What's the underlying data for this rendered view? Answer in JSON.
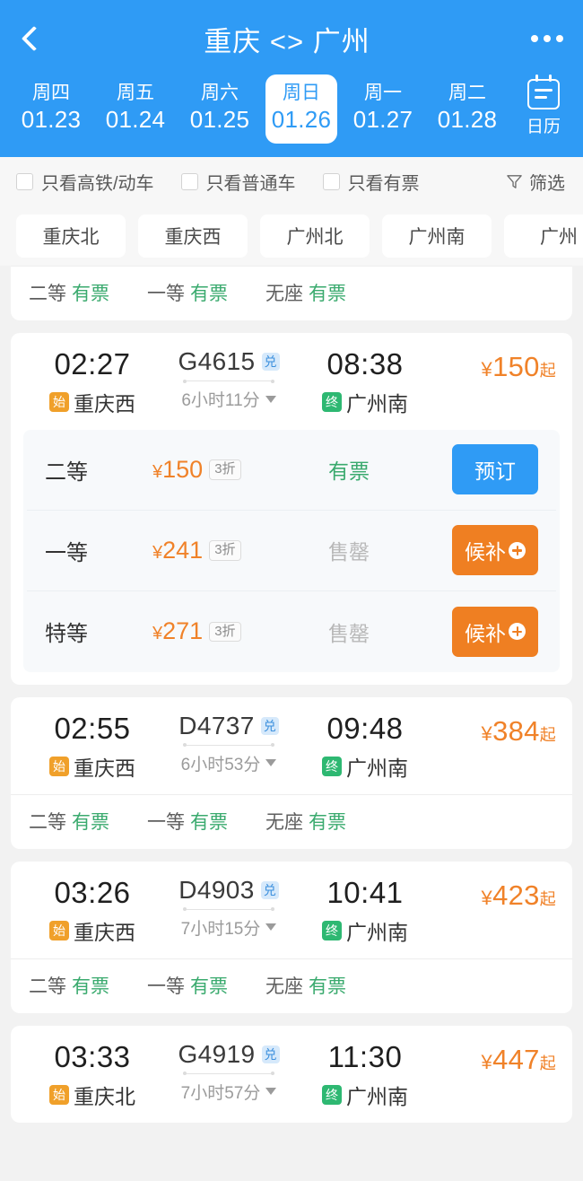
{
  "header": {
    "title": "重庆 <> 广州",
    "back_icon": "chevron-left-icon",
    "more_icon": "more-horizontal-icon",
    "calendar": {
      "icon": "calendar-icon",
      "label": "日历"
    },
    "dates": [
      {
        "dow": "周四",
        "date": "01.23",
        "active": false
      },
      {
        "dow": "周五",
        "date": "01.24",
        "active": false
      },
      {
        "dow": "周六",
        "date": "01.25",
        "active": false
      },
      {
        "dow": "周日",
        "date": "01.26",
        "active": true
      },
      {
        "dow": "周一",
        "date": "01.27",
        "active": false
      },
      {
        "dow": "周二",
        "date": "01.28",
        "active": false
      }
    ]
  },
  "filters": {
    "checkboxes": [
      {
        "label": "只看高铁/动车",
        "checked": false
      },
      {
        "label": "只看普通车",
        "checked": false
      },
      {
        "label": "只看有票",
        "checked": false
      }
    ],
    "filter_button": {
      "label": "筛选",
      "icon": "funnel-icon"
    }
  },
  "station_chips": [
    "重庆北",
    "重庆西",
    "广州北",
    "广州南",
    "广州"
  ],
  "partial_card": {
    "seats": [
      {
        "class": "二等",
        "status": "有票",
        "sold_out": false
      },
      {
        "class": "一等",
        "status": "有票",
        "sold_out": false
      },
      {
        "class": "无座",
        "status": "有票",
        "sold_out": false
      }
    ]
  },
  "colors": {
    "brand_blue": "#2f9bf5",
    "price_orange": "#f08229",
    "wait_orange": "#ef7f22",
    "avail_green": "#3aaa6e",
    "sold_gray": "#b8b8b8",
    "start_tag": "#f0a02a",
    "end_tag": "#2eb872"
  },
  "trains": [
    {
      "depart_time": "02:27",
      "depart_station": "重庆西",
      "depart_tag": "始",
      "code": "G4615",
      "code_badge": "兑",
      "duration": "6小时11分",
      "arrive_time": "08:38",
      "arrive_station": "广州南",
      "arrive_tag": "终",
      "price_prefix": "¥",
      "price": "150",
      "price_suffix": "起",
      "expanded": true,
      "seat_rows": [
        {
          "class": "二等",
          "price": "150",
          "discount": "3折",
          "status": "有票",
          "sold_out": false,
          "action": "预订",
          "action_type": "book"
        },
        {
          "class": "一等",
          "price": "241",
          "discount": "3折",
          "status": "售罄",
          "sold_out": true,
          "action": "候补",
          "action_type": "wait"
        },
        {
          "class": "特等",
          "price": "271",
          "discount": "3折",
          "status": "售罄",
          "sold_out": true,
          "action": "候补",
          "action_type": "wait"
        }
      ]
    },
    {
      "depart_time": "02:55",
      "depart_station": "重庆西",
      "depart_tag": "始",
      "code": "D4737",
      "code_badge": "兑",
      "duration": "6小时53分",
      "arrive_time": "09:48",
      "arrive_station": "广州南",
      "arrive_tag": "终",
      "price_prefix": "¥",
      "price": "384",
      "price_suffix": "起",
      "expanded": false,
      "seats": [
        {
          "class": "二等",
          "status": "有票",
          "sold_out": false
        },
        {
          "class": "一等",
          "status": "有票",
          "sold_out": false
        },
        {
          "class": "无座",
          "status": "有票",
          "sold_out": false
        }
      ]
    },
    {
      "depart_time": "03:26",
      "depart_station": "重庆西",
      "depart_tag": "始",
      "code": "D4903",
      "code_badge": "兑",
      "duration": "7小时15分",
      "arrive_time": "10:41",
      "arrive_station": "广州南",
      "arrive_tag": "终",
      "price_prefix": "¥",
      "price": "423",
      "price_suffix": "起",
      "expanded": false,
      "seats": [
        {
          "class": "二等",
          "status": "有票",
          "sold_out": false
        },
        {
          "class": "一等",
          "status": "有票",
          "sold_out": false
        },
        {
          "class": "无座",
          "status": "有票",
          "sold_out": false
        }
      ]
    },
    {
      "depart_time": "03:33",
      "depart_station": "重庆北",
      "depart_tag": "始",
      "code": "G4919",
      "code_badge": "兑",
      "duration": "7小时57分",
      "arrive_time": "11:30",
      "arrive_station": "广州南",
      "arrive_tag": "终",
      "price_prefix": "¥",
      "price": "447",
      "price_suffix": "起",
      "expanded": false,
      "seats": []
    }
  ]
}
